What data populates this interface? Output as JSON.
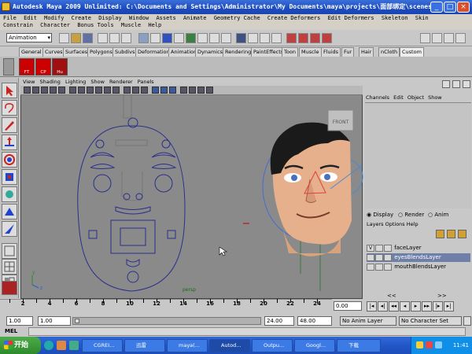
{
  "window": {
    "title": "Autodesk Maya 2009 Unlimited: C:\\Documents and Settings\\Administrator\\My Documents\\maya\\projects\\面部绑定\\scenes\\",
    "buttons": {
      "minimize": "_",
      "maximize": "□",
      "close": "×"
    }
  },
  "menubar": [
    "File",
    "Edit",
    "Modify",
    "Create",
    "Display",
    "Window",
    "Assets",
    "Animate",
    "Geometry Cache",
    "Create Deformers",
    "Edit Deformers",
    "Skeleton",
    "Skin",
    "Constrain",
    "Character",
    "Bonus Tools",
    "Muscle",
    "Help"
  ],
  "statusline": {
    "module": "Animation"
  },
  "shelf_tabs": [
    "General",
    "Curves",
    "Surfaces",
    "Polygons",
    "Subdivs",
    "Deformation",
    "Animation",
    "Dynamics",
    "Rendering",
    "PaintEffects",
    "Toon",
    "Muscle",
    "Fluids",
    "Fur",
    "Hair",
    "nCloth",
    "Custom"
  ],
  "shelf_active": "Custom",
  "shelf_buttons": [
    "FT",
    "CP",
    "Hu"
  ],
  "panel": {
    "menu": [
      "View",
      "Shading",
      "Lighting",
      "Show",
      "Renderer",
      "Panels"
    ],
    "camera_label": "persp",
    "viewcube": "FRONT",
    "axis": {
      "y": "y",
      "z": "z"
    }
  },
  "channel_box": {
    "menu": [
      "Channels",
      "Edit",
      "Object",
      "Show"
    ]
  },
  "layer_editor": {
    "modes": [
      {
        "label": "Display",
        "checked": true
      },
      {
        "label": "Render",
        "checked": false
      },
      {
        "label": "Anim",
        "checked": false
      }
    ],
    "menu": [
      "Layers",
      "Options",
      "Help"
    ],
    "layers": [
      {
        "v": "V",
        "name": "faceLayer",
        "selected": false
      },
      {
        "v": "",
        "name": "eyesBlendsLayer",
        "selected": true
      },
      {
        "v": "",
        "name": "mouthBlendsLayer",
        "selected": false
      }
    ]
  },
  "timeline": {
    "ticks": [
      1,
      2,
      4,
      6,
      8,
      10,
      12,
      14,
      16,
      18,
      20,
      22,
      24
    ],
    "labels": [
      "2",
      "4",
      "6",
      "8",
      "10",
      "12",
      "14",
      "16",
      "18",
      "20",
      "22",
      "24"
    ],
    "current_time": "0.00"
  },
  "range": {
    "start": "1.00",
    "playback_start": "1.00",
    "playback_end": "24.00",
    "end": "48.00",
    "anim_layer": "No Anim Layer",
    "character_set": "No Character Set"
  },
  "command_line": {
    "label": "MEL"
  },
  "taskbar": {
    "start": "开始",
    "tasks": [
      "CGREI...",
      "迅雷",
      "maya(...",
      "Autod...",
      "Outpu...",
      "Googl...",
      "下载"
    ],
    "active_task": 3,
    "clock": "11:41"
  },
  "colors": {
    "viewport_bg": "#8a8a8a",
    "curve": "#2a2f8a",
    "selected_layer": "#6e7fa8",
    "titlebar": "#1d4cc0"
  }
}
